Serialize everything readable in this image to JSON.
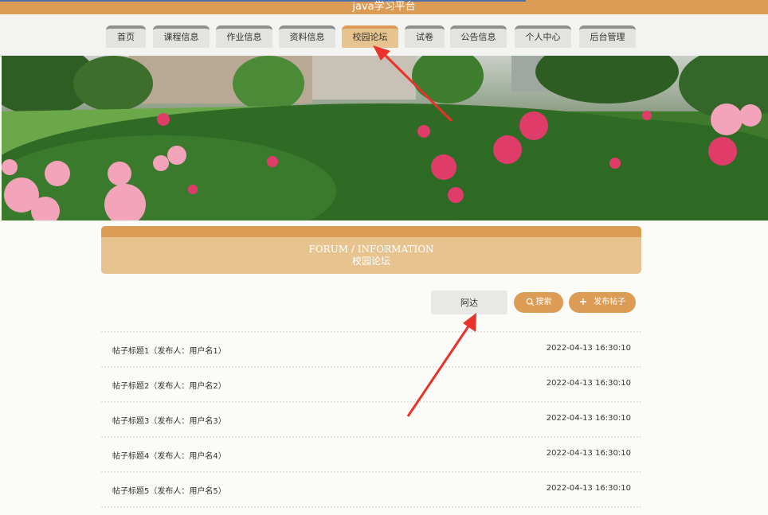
{
  "header": {
    "title": "java学习平台"
  },
  "nav": {
    "items": [
      {
        "label": "首页"
      },
      {
        "label": "课程信息"
      },
      {
        "label": "作业信息"
      },
      {
        "label": "资料信息"
      },
      {
        "label": "校园论坛"
      },
      {
        "label": "试卷"
      },
      {
        "label": "公告信息"
      },
      {
        "label": "个人中心"
      },
      {
        "label": "后台管理"
      }
    ],
    "active": "校园论坛"
  },
  "forum": {
    "title_en": "FORUM / INFORMATION",
    "title_cn": "校园论坛",
    "search_value": "阿达",
    "search_button": "搜索",
    "add_button": "发布帖子",
    "posts": [
      {
        "title": "帖子标题1（发布人：用户名1）",
        "time": "2022-04-13 16:30:10"
      },
      {
        "title": "帖子标题2（发布人：用户名2）",
        "time": "2022-04-13 16:30:10"
      },
      {
        "title": "帖子标题3（发布人：用户名3）",
        "time": "2022-04-13 16:30:10"
      },
      {
        "title": "帖子标题4（发布人：用户名4）",
        "time": "2022-04-13 16:30:10"
      },
      {
        "title": "帖子标题5（发布人：用户名5）",
        "time": "2022-04-13 16:30:10"
      }
    ]
  },
  "colors": {
    "accent": "#dd9c55",
    "accent_light": "#e6c38f",
    "annotation_arrow": "#e8322a"
  }
}
